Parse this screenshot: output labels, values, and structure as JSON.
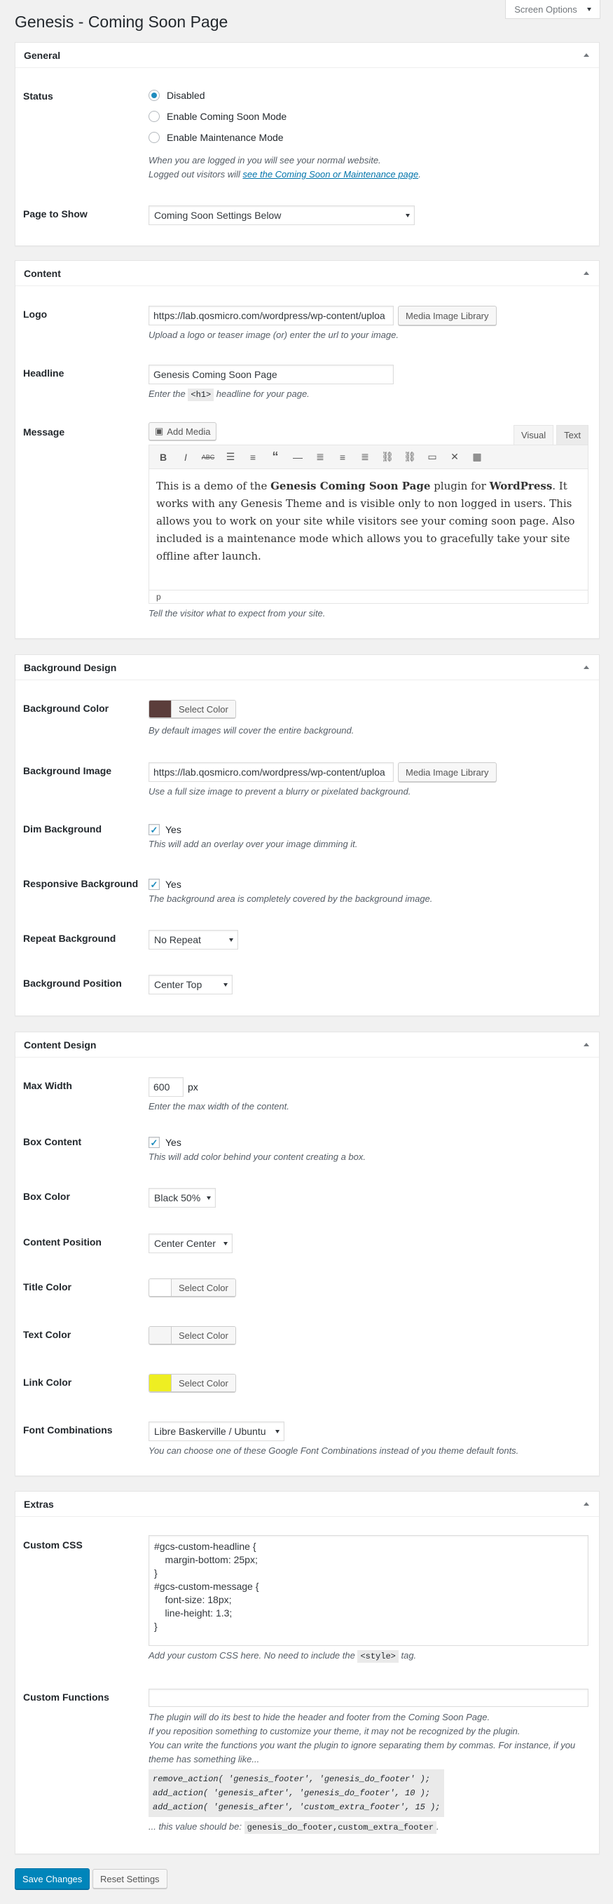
{
  "page_title": "Genesis - Coming Soon Page",
  "screen_options": "Screen Options",
  "general": {
    "title": "General",
    "status_label": "Status",
    "status_options": [
      "Disabled",
      "Enable Coming Soon Mode",
      "Enable Maintenance Mode"
    ],
    "status_selected": "Disabled",
    "status_desc_1": "When you are logged in you will see your normal website.",
    "status_desc_2_prefix": "Logged out visitors will ",
    "status_desc_2_link": "see the Coming Soon or Maintenance page",
    "status_desc_2_suffix": ".",
    "page_to_show_label": "Page to Show",
    "page_to_show_value": "Coming Soon Settings Below"
  },
  "content": {
    "title": "Content",
    "logo_label": "Logo",
    "logo_value": "https://lab.qosmicro.com/wordpress/wp-content/uploa",
    "logo_button": "Media Image Library",
    "logo_desc": "Upload a logo or teaser image (or) enter the url to your image.",
    "headline_label": "Headline",
    "headline_value": "Genesis Coming Soon Page",
    "headline_desc_prefix": "Enter the ",
    "headline_desc_code": "<h1>",
    "headline_desc_suffix": " headline for your page.",
    "message_label": "Message",
    "add_media": "Add Media",
    "tab_visual": "Visual",
    "tab_text": "Text",
    "message_p1": "This is a demo of the ",
    "message_b1": "Genesis Coming Soon Page",
    "message_p2": " plugin for ",
    "message_b2": "WordPress",
    "message_p3": ". It works with any Genesis Theme and is visible only to non logged in users. This allows you to work on your site while visitors see your coming soon page. Also included is a maintenance mode which allows you to gracefully take your site offline after launch.",
    "editor_status": "p",
    "message_desc": "Tell the visitor what to expect from your site."
  },
  "background_design": {
    "title": "Background Design",
    "bg_color_label": "Background Color",
    "bg_color": "#5b3d3b",
    "select_color": "Select Color",
    "bg_color_desc": "By default images will cover the entire background.",
    "bg_image_label": "Background Image",
    "bg_image_value": "https://lab.qosmicro.com/wordpress/wp-content/uploa",
    "bg_image_button": "Media Image Library",
    "bg_image_desc": "Use a full size image to prevent a blurry or pixelated background.",
    "dim_label": "Dim Background",
    "dim_yes": "Yes",
    "dim_desc": "This will add an overlay over your image dimming it.",
    "responsive_label": "Responsive Background",
    "responsive_yes": "Yes",
    "responsive_desc": "The background area is completely covered by the background image.",
    "repeat_label": "Repeat Background",
    "repeat_value": "No Repeat",
    "position_label": "Background Position",
    "position_value": "Center Top"
  },
  "content_design": {
    "title": "Content Design",
    "max_width_label": "Max Width",
    "max_width_value": "600",
    "max_width_unit": "px",
    "max_width_desc": "Enter the max width of the content.",
    "box_content_label": "Box Content",
    "box_content_yes": "Yes",
    "box_content_desc": "This will add color behind your content creating a box.",
    "box_color_label": "Box Color",
    "box_color_value": "Black 50%",
    "content_position_label": "Content Position",
    "content_position_value": "Center Center",
    "title_color_label": "Title Color",
    "title_color": "#ffffff",
    "text_color_label": "Text Color",
    "text_color": "#f5f5f5",
    "link_color_label": "Link Color",
    "link_color": "#eeee22",
    "select_color": "Select Color",
    "font_label": "Font Combinations",
    "font_value": "Libre Baskerville / Ubuntu",
    "font_desc": "You can choose one of these Google Font Combinations instead of you theme default fonts."
  },
  "extras": {
    "title": "Extras",
    "custom_css_label": "Custom CSS",
    "custom_css_value": "#gcs-custom-headline {\n    margin-bottom: 25px;\n}\n#gcs-custom-message {\n    font-size: 18px;\n    line-height: 1.3;\n}",
    "custom_css_desc_prefix": "Add your custom CSS here. No need to include the ",
    "custom_css_desc_code": "<style>",
    "custom_css_desc_suffix": " tag.",
    "custom_functions_label": "Custom Functions",
    "custom_functions_value": "",
    "cf_desc_1": "The plugin will do its best to hide the header and footer from the Coming Soon Page.",
    "cf_desc_2": "If you reposition something to customize your theme, it may not be recognized by the plugin.",
    "cf_desc_3": "You can write the functions you want the plugin to ignore separating them by commas. For instance, if you theme has something like...",
    "cf_code": "remove_action( 'genesis_footer', 'genesis_do_footer' );\nadd_action( 'genesis_after', 'genesis_do_footer', 10 );\nadd_action( 'genesis_after', 'custom_extra_footer', 15 );",
    "cf_desc_4_prefix": "... this value should be: ",
    "cf_desc_4_code": "genesis_do_footer,custom_extra_footer",
    "cf_desc_4_suffix": "."
  },
  "buttons": {
    "save": "Save Changes",
    "reset": "Reset Settings"
  }
}
